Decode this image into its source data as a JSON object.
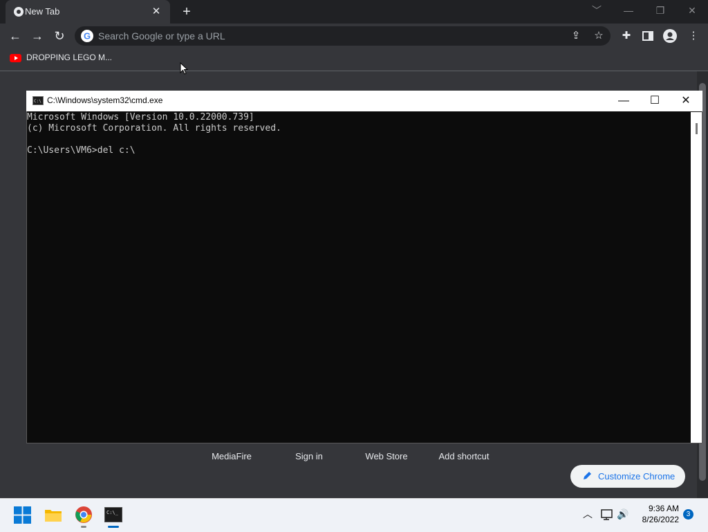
{
  "browser": {
    "tab_title": "New Tab",
    "tab_close": "✕",
    "new_tab": "+",
    "window_controls": [
      "﹀",
      "—",
      "❐",
      "✕"
    ],
    "omnibox_placeholder": "Search Google or type a URL",
    "bookmark": "DROPPING LEGO M..."
  },
  "ntp": {
    "shortcuts": [
      "MediaFire",
      "Sign in",
      "Web Store",
      "Add shortcut"
    ],
    "customize_label": "Customize Chrome"
  },
  "cmd": {
    "title": "C:\\Windows\\system32\\cmd.exe",
    "controls": [
      "—",
      "☐",
      "✕"
    ],
    "lines": [
      "Microsoft Windows [Version 10.0.22000.739]",
      "(c) Microsoft Corporation. All rights reserved.",
      "",
      "C:\\Users\\VM6>del c:\\"
    ]
  },
  "taskbar": {
    "time": "9:36 AM",
    "date": "8/26/2022",
    "notification_count": "3"
  },
  "colors": {
    "chrome_bg": "#35363a",
    "accent": "#1a73e8",
    "cmd_bg": "#0c0c0c"
  }
}
